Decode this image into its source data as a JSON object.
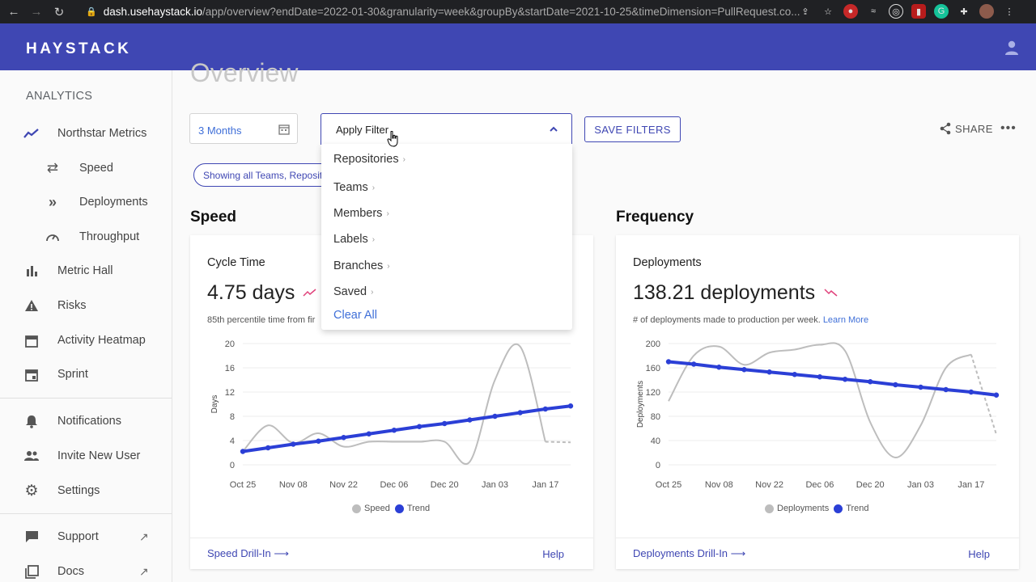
{
  "browser": {
    "url_host": "dash.usehaystack.io",
    "url_rest": "/app/overview?endDate=2022-01-30&granularity=week&groupBy&startDate=2021-10-25&timeDimension=PullRequest.co..."
  },
  "header": {
    "logo": "HAYSTACK"
  },
  "sidebar": {
    "section": "ANALYTICS",
    "items": [
      {
        "label": "Northstar Metrics",
        "icon": "trend-line-icon"
      },
      {
        "label": "Speed",
        "icon": "repeat-icon"
      },
      {
        "label": "Deployments",
        "icon": "double-chevron-icon"
      },
      {
        "label": "Throughput",
        "icon": "gauge-icon"
      },
      {
        "label": "Metric Hall",
        "icon": "bar-chart-icon"
      },
      {
        "label": "Risks",
        "icon": "warning-icon"
      },
      {
        "label": "Activity Heatmap",
        "icon": "calendar-icon"
      },
      {
        "label": "Sprint",
        "icon": "calendar-event-icon"
      },
      {
        "label": "Notifications",
        "icon": "bell-icon"
      },
      {
        "label": "Invite New User",
        "icon": "people-icon"
      },
      {
        "label": "Settings",
        "icon": "gear-icon"
      },
      {
        "label": "Support",
        "icon": "chat-icon"
      },
      {
        "label": "Docs",
        "icon": "docs-icon"
      }
    ]
  },
  "main": {
    "page_title": "Overview",
    "date_range": "3 Months",
    "filter_label": "Apply Filter",
    "save_filters": "SAVE FILTERS",
    "share": "SHARE",
    "more": "•••",
    "chip": "Showing all Teams, Reposit"
  },
  "filter_menu": {
    "items": [
      "Repositories",
      "Teams",
      "Members",
      "Labels",
      "Branches",
      "Saved"
    ],
    "clear": "Clear All"
  },
  "sections": {
    "speed": "Speed",
    "frequency": "Frequency"
  },
  "colors": {
    "accent": "#3f47b3",
    "trend": "#2b3fd6",
    "series": "#bdbdbd",
    "up_trend": "#e0407a"
  },
  "cards": {
    "cycle": {
      "title": "Cycle Time",
      "value": "4.75 days",
      "desc": "85th percentile time from fir",
      "drill": "Speed Drill-In ⟶",
      "help": "Help",
      "legend_series": "Speed",
      "legend_trend": "Trend"
    },
    "deploy": {
      "title": "Deployments",
      "value": "138.21 deployments",
      "desc": "# of deployments made to production per week.",
      "learn_more": "Learn More",
      "drill": "Deployments Drill-In ⟶",
      "help": "Help",
      "legend_series": "Deployments",
      "legend_trend": "Trend"
    }
  },
  "chart_data": [
    {
      "type": "line",
      "ylabel": "Days",
      "x_ticks": [
        "Oct 25",
        "Nov 08",
        "Nov 22",
        "Dec 06",
        "Dec 20",
        "Jan 03",
        "Jan 17"
      ],
      "y_ticks": [
        0,
        4,
        8,
        12,
        16,
        20
      ],
      "ylim": [
        0,
        20
      ],
      "series": [
        {
          "name": "Speed",
          "values": [
            2.2,
            6.5,
            3.6,
            5.2,
            3.0,
            3.8,
            3.8,
            3.8,
            3.8,
            0.5,
            14,
            19.5,
            3.8,
            3.7
          ],
          "dashed_from": 12
        },
        {
          "name": "Trend",
          "values": [
            2.2,
            2.8,
            3.4,
            3.9,
            4.5,
            5.1,
            5.7,
            6.3,
            6.8,
            7.4,
            8.0,
            8.6,
            9.2,
            9.7
          ]
        }
      ]
    },
    {
      "type": "line",
      "ylabel": "Deployments",
      "x_ticks": [
        "Oct 25",
        "Nov 08",
        "Nov 22",
        "Dec 06",
        "Dec 20",
        "Jan 03",
        "Jan 17"
      ],
      "y_ticks": [
        0,
        40,
        80,
        120,
        160,
        200
      ],
      "ylim": [
        0,
        200
      ],
      "series": [
        {
          "name": "Deployments",
          "values": [
            105,
            180,
            195,
            165,
            185,
            190,
            198,
            188,
            70,
            12,
            65,
            160,
            182,
            50
          ],
          "dashed_from": 12
        },
        {
          "name": "Trend",
          "values": [
            170,
            166,
            161,
            157,
            153,
            149,
            145,
            141,
            137,
            132,
            128,
            124,
            120,
            115
          ]
        }
      ]
    }
  ]
}
